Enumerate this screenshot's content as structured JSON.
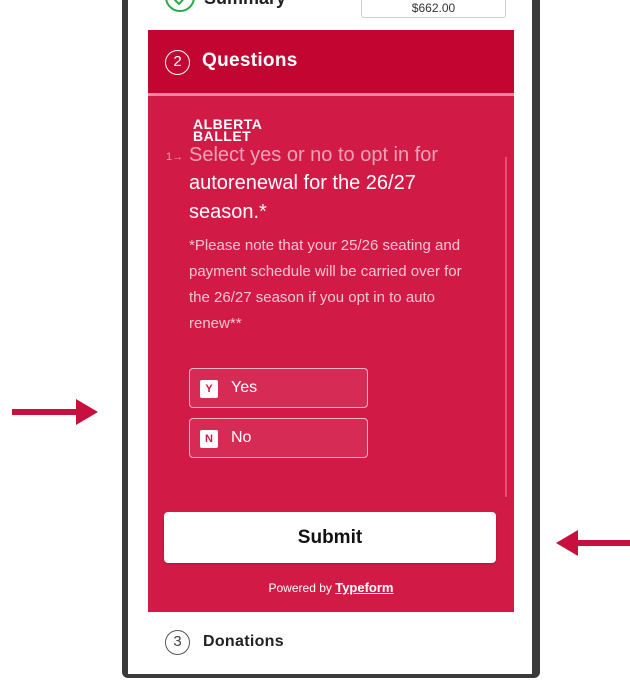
{
  "steps": {
    "summary": {
      "label": "Summary",
      "price": "$662.00"
    },
    "questions": {
      "number": "2",
      "title": "Questions"
    },
    "donations": {
      "number": "3",
      "title": "Donations"
    }
  },
  "form": {
    "logo_line1": "ALBERTA",
    "logo_line2": "BALLET",
    "question_number": "1→",
    "question_line1": "Select yes or no to opt in for",
    "question_rest": "autorenewal for the 26/27 season.*",
    "note": "*Please note that your 25/26 seating and payment schedule will be carried over for the 26/27 season if you opt in to auto renew**",
    "choices": [
      {
        "key": "Y",
        "label": "Yes"
      },
      {
        "key": "N",
        "label": "No"
      }
    ],
    "submit_label": "Submit",
    "powered_prefix": "Powered by",
    "powered_brand": "Typeform"
  },
  "colors": {
    "accent": "#c30532",
    "form_bg": "#d21a47",
    "arrow": "#c8103e",
    "check": "#2aa946"
  },
  "icons": {
    "check": "check-icon",
    "arrow_right": "arrow-right-icon",
    "arrow_left": "arrow-left-icon"
  }
}
